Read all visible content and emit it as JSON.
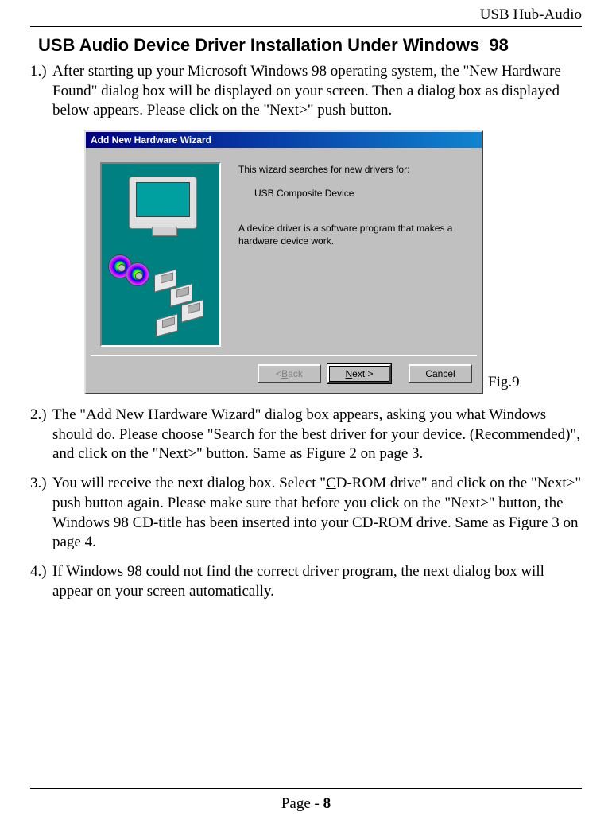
{
  "header": {
    "label": "USB Hub-Audio"
  },
  "title": "USB Audio Device Driver Installation Under Windows  98",
  "steps": {
    "s1": {
      "num": "1.)",
      "text": "After starting up your Microsoft Windows 98 operating system, the \"New Hardware Found\" dialog box will be displayed on your screen. Then a dialog box as displayed below appears. Please click on the \"Next>\" push button."
    },
    "s2": {
      "num": "2.)",
      "text": "The \"Add New Hardware Wizard\" dialog box appears, asking you what Windows should do. Please choose \"Search for the best driver for your device. (Recommended)\", and click on the \"Next>\" button. Same as Figure 2 on page 3."
    },
    "s3": {
      "num": "3.)",
      "text_a": "You will receive the next dialog box. Select \"",
      "cdrom_c": "C",
      "text_b": "D-ROM drive\" and click on the \"Next>\" push button again. Please make sure that before you click on the \"Next>\" button, the Windows 98 CD-title has been inserted into your CD-ROM drive. Same as Figure 3 on page 4."
    },
    "s4": {
      "num": "4.)",
      "text": "If Windows 98 could not find the correct driver program, the next dialog box will appear on your screen automatically."
    }
  },
  "figure": {
    "label": "Fig.9"
  },
  "wizard": {
    "title": "Add New Hardware Wizard",
    "line1": "This wizard searches for new drivers for:",
    "device": "USB Composite Device",
    "line2": "A device driver is a software program that makes a hardware device work.",
    "buttons": {
      "back_pre": "< ",
      "back_u": "B",
      "back_post": "ack",
      "next_pre": "",
      "next_u": "N",
      "next_post": "ext >",
      "cancel": "Cancel"
    }
  },
  "footer": {
    "text_a": "Page - ",
    "text_b": "8"
  }
}
